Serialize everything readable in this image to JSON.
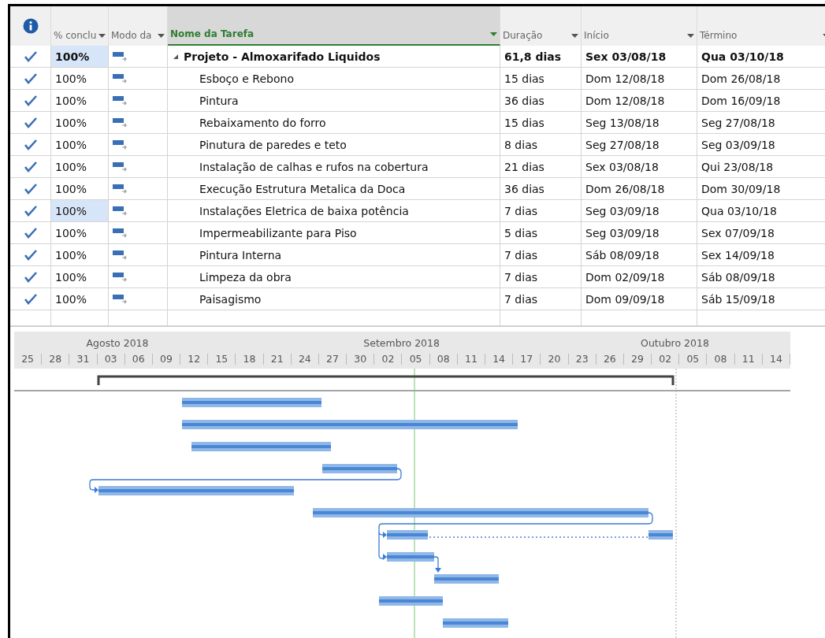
{
  "table": {
    "columns": [
      {
        "label": "% conclu",
        "dropdown": true
      },
      {
        "label": "Modo da",
        "dropdown": true
      },
      {
        "label": "Nome da Tarefa",
        "dropdown": true
      },
      {
        "label": "Duração",
        "dropdown": true
      },
      {
        "label": "Início",
        "dropdown": true
      },
      {
        "label": "Término",
        "dropdown": true
      }
    ],
    "rows": [
      {
        "kind": "summary",
        "done": true,
        "percent": "100%",
        "percent_selected": true,
        "name": "Projeto - Almoxarifado Liquidos",
        "duration": "61,8 dias",
        "start": "Sex 03/08/18",
        "finish": "Qua 03/10/18",
        "expanded": true,
        "children": [
          {
            "kind": "task",
            "done": true,
            "percent": "100%",
            "percent_selected": false,
            "name": "Esboço e Rebono",
            "duration": "15 dias",
            "start": "Dom 12/08/18",
            "finish": "Dom 26/08/18"
          },
          {
            "kind": "task",
            "done": true,
            "percent": "100%",
            "percent_selected": false,
            "name": "Pintura",
            "duration": "36 dias",
            "start": "Dom 12/08/18",
            "finish": "Dom 16/09/18"
          },
          {
            "kind": "task",
            "done": true,
            "percent": "100%",
            "percent_selected": false,
            "name": "Rebaixamento do forro",
            "duration": "15 dias",
            "start": "Seg 13/08/18",
            "finish": "Seg 27/08/18"
          },
          {
            "kind": "task",
            "done": true,
            "percent": "100%",
            "percent_selected": false,
            "name": "Pinutura de paredes e teto",
            "duration": "8 dias",
            "start": "Seg 27/08/18",
            "finish": "Seg 03/09/18"
          },
          {
            "kind": "task",
            "done": true,
            "percent": "100%",
            "percent_selected": false,
            "name": "Instalação de calhas e rufos na cobertura",
            "duration": "21 dias",
            "start": "Sex 03/08/18",
            "finish": "Qui 23/08/18"
          },
          {
            "kind": "task",
            "done": true,
            "percent": "100%",
            "percent_selected": false,
            "name": "Execução Estrutura Metalica da Doca",
            "duration": "36 dias",
            "start": "Dom 26/08/18",
            "finish": "Dom 30/09/18"
          },
          {
            "kind": "task",
            "done": true,
            "percent": "100%",
            "percent_selected": true,
            "name": "Instalações Eletrica de baixa potência",
            "duration": "7 dias",
            "start": "Seg 03/09/18",
            "finish": "Qua 03/10/18"
          },
          {
            "kind": "task",
            "done": true,
            "percent": "100%",
            "percent_selected": false,
            "name": "Impermeabilizante para Piso",
            "duration": "5 dias",
            "start": "Seg 03/09/18",
            "finish": "Sex 07/09/18"
          },
          {
            "kind": "task",
            "done": true,
            "percent": "100%",
            "percent_selected": false,
            "name": "Pintura Interna",
            "duration": "7 dias",
            "start": "Sáb 08/09/18",
            "finish": "Sex 14/09/18"
          },
          {
            "kind": "task",
            "done": true,
            "percent": "100%",
            "percent_selected": false,
            "name": "Limpeza da obra",
            "duration": "7 dias",
            "start": "Dom 02/09/18",
            "finish": "Sáb 08/09/18"
          },
          {
            "kind": "task",
            "done": true,
            "percent": "100%",
            "percent_selected": false,
            "name": "Paisagismo",
            "duration": "7 dias",
            "start": "Dom 09/09/18",
            "finish": "Sáb 15/09/18"
          }
        ]
      }
    ]
  },
  "timescale": {
    "months": [
      "Agosto 2018",
      "Setembro 2018",
      "Outubro 2018"
    ],
    "days": [
      "25",
      "28",
      "31",
      "03",
      "06",
      "09",
      "12",
      "15",
      "18",
      "21",
      "24",
      "27",
      "30",
      "02",
      "05",
      "08",
      "11",
      "14",
      "17",
      "20",
      "23",
      "26",
      "29",
      "02",
      "05",
      "08",
      "11",
      "14"
    ]
  }
}
